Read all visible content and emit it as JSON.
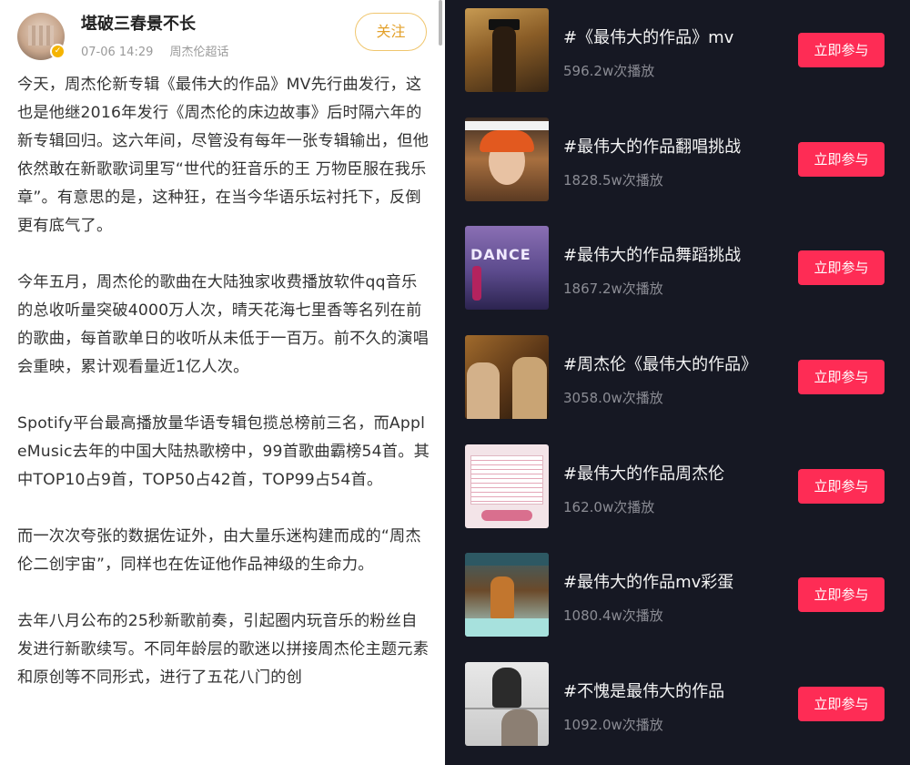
{
  "post": {
    "author": "堪破三春景不长",
    "time": "07-06 14:29",
    "source": "周杰伦超话",
    "follow_label": "关注",
    "paragraphs": [
      "今天，周杰伦新专辑《最伟大的作品》MV先行曲发行，这也是他继2016年发行《周杰伦的床边故事》后时隔六年的新专辑回归。这六年间，尽管没有每年一张专辑输出，但他依然敢在新歌歌词里写“世代的狂音乐的王 万物臣服在我乐章”。有意思的是，这种狂，在当今华语乐坛衬托下，反倒更有底气了。",
      "今年五月，周杰伦的歌曲在大陆独家收费播放软件qq音乐的总收听量突破4000万人次，晴天花海七里香等名列在前的歌曲，每首歌单日的收听从未低于一百万。前不久的演唱会重映，累计观看量近1亿人次。",
      "Spotify平台最高播放量华语专辑包揽总榜前三名，而AppleMusic去年的中国大陆热歌榜中，99首歌曲霸榜54首。其中TOP10占9首，TOP50占42首，TOP99占54首。",
      "而一次次夸张的数据佐证外，由大量乐迷构建而成的“周杰伦二创宇宙”，同样也在佐证他作品神级的生命力。",
      "去年八月公布的25秒新歌前奏，引起圈内玩音乐的粉丝自发进行新歌续写。不同年龄层的歌迷以拼接周杰伦主题元素和原创等不同形式，进行了五花八门的创"
    ]
  },
  "challenges": {
    "join_label": "立即参与",
    "thumb_dance_text": "DANCE",
    "items": [
      {
        "title": "#《最伟大的作品》mv",
        "plays": "596.2w次播放",
        "thumb": "mv-still-thumbnail"
      },
      {
        "title": "#最伟大的作品翻唱挑战",
        "plays": "1828.5w次播放",
        "thumb": "cover-singer-thumbnail"
      },
      {
        "title": "#最伟大的作品舞蹈挑战",
        "plays": "1867.2w次播放",
        "thumb": "dance-thumbnail"
      },
      {
        "title": "#周杰伦《最伟大的作品》",
        "plays": "3058.0w次播放",
        "thumb": "two-people-thumbnail"
      },
      {
        "title": "#最伟大的作品周杰伦",
        "plays": "162.0w次播放",
        "thumb": "chart-sheet-thumbnail"
      },
      {
        "title": "#最伟大的作品mv彩蛋",
        "plays": "1080.4w次播放",
        "thumb": "mv-easter-egg-thumbnail"
      },
      {
        "title": "#不愧是最伟大的作品",
        "plays": "1092.0w次播放",
        "thumb": "piano-thumbnail"
      }
    ]
  },
  "colors": {
    "accent_red": "#fe2c55",
    "dark_bg": "#161823",
    "follow_gold": "#e3a12b"
  }
}
